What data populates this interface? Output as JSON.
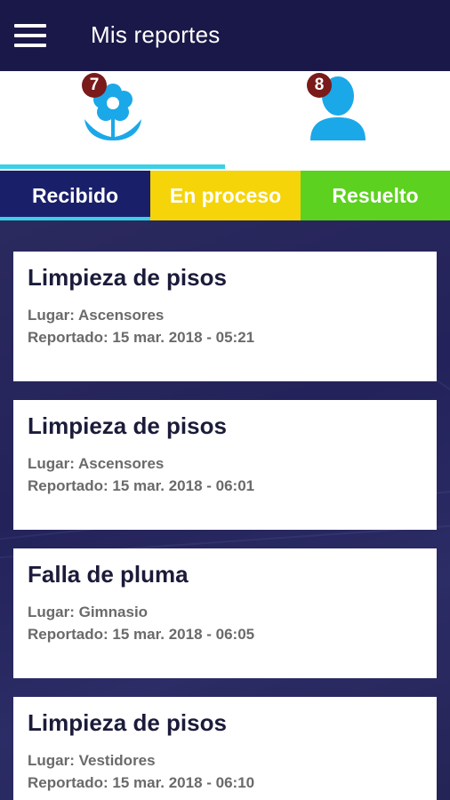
{
  "appbar": {
    "title": "Mis reportes"
  },
  "icon_tabs": [
    {
      "icon": "flower-icon",
      "badge": "7",
      "color": "#1aa8e8"
    },
    {
      "icon": "user-icon",
      "badge": "8",
      "color": "#1aa8e8"
    }
  ],
  "status_tabs": [
    {
      "label": "Recibido",
      "color": "#1a1f6a"
    },
    {
      "label": "En proceso",
      "color": "#f5d40a"
    },
    {
      "label": "Resuelto",
      "color": "#5cd11f"
    }
  ],
  "reports": [
    {
      "title": "Limpieza de pisos",
      "place": "Lugar: Ascensores",
      "date": "Reportado: 15 mar. 2018 - 05:21"
    },
    {
      "title": "Limpieza de pisos",
      "place": "Lugar: Ascensores",
      "date": "Reportado: 15 mar. 2018 - 06:01"
    },
    {
      "title": "Falla de pluma",
      "place": "Lugar: Gimnasio",
      "date": "Reportado: 15 mar. 2018 - 06:05"
    },
    {
      "title": "Limpieza de pisos",
      "place": "Lugar: Vestidores",
      "date": "Reportado: 15 mar. 2018 - 06:10"
    }
  ]
}
